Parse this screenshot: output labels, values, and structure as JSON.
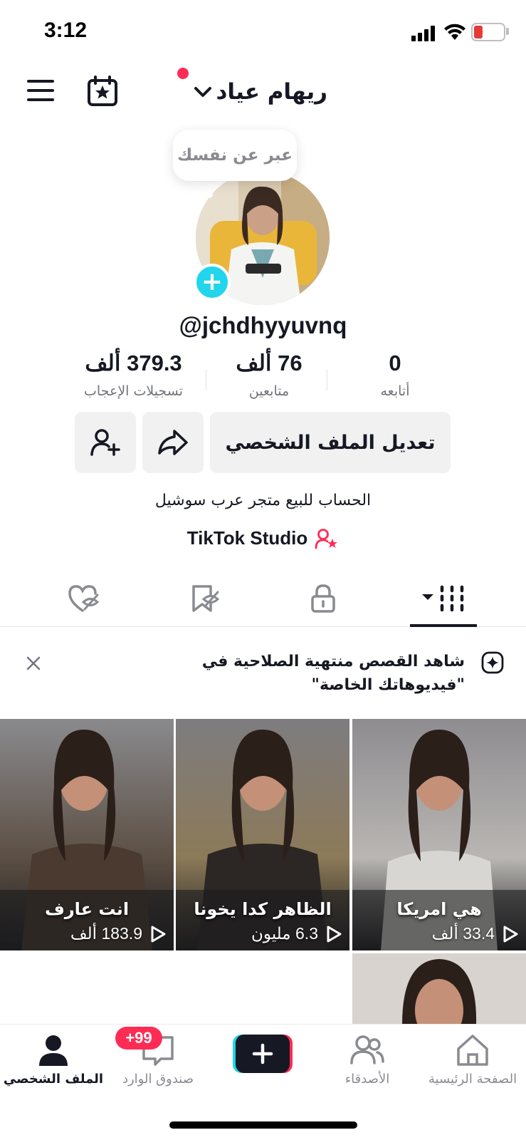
{
  "status_bar": {
    "time": "3:12",
    "battery": "15"
  },
  "header": {
    "username": "ريهام عياد"
  },
  "profile": {
    "bubble_text": "عبر عن نفسك",
    "handle": "@jchdhyyuvnq",
    "stats": {
      "following": {
        "value": "0",
        "label": "أتابعه"
      },
      "followers": {
        "value": "76 ألف",
        "label": "متابعين"
      },
      "likes": {
        "value": "379.3 ألف",
        "label": "تسجيلات الإعجاب"
      }
    },
    "edit_button_label": "تعديل الملف الشخصي",
    "bio": "الحساب للبيع متجر عرب سوشيل",
    "studio_label": "TikTok Studio"
  },
  "banner": {
    "line1": "شاهد القصص منتهية الصلاحية في",
    "line2": "\"فيديوهاتك الخاصة\""
  },
  "videos": [
    {
      "caption": "هي امريكا",
      "views": "33.4 ألف"
    },
    {
      "caption": "الظاهر كدا يخونا",
      "views": "6.3 مليون"
    },
    {
      "caption": "انت عارف",
      "views": "183.9 ألف"
    }
  ],
  "bottom_nav": {
    "home": "الصفحة الرئيسية",
    "friends": "الأصدقاء",
    "inbox": "صندوق الوارد",
    "inbox_badge": "+99",
    "profile": "الملف الشخصي"
  },
  "icons": [
    "menu-icon",
    "calendar-star-icon",
    "chevron-down-icon",
    "plus-icon",
    "share-icon",
    "add-friend-icon",
    "creator-icon",
    "grid-icon",
    "lock-icon",
    "bookmark-icon",
    "liked-icon",
    "close-icon",
    "sparkle-icon",
    "play-icon",
    "home-icon",
    "friends-icon",
    "inbox-icon",
    "profile-icon"
  ],
  "colors": {
    "accent_red": "#fe2c55",
    "accent_cyan": "#20d5ec",
    "text": "#161823",
    "muted": "#73757c",
    "button_bg": "#f1f1f2"
  }
}
